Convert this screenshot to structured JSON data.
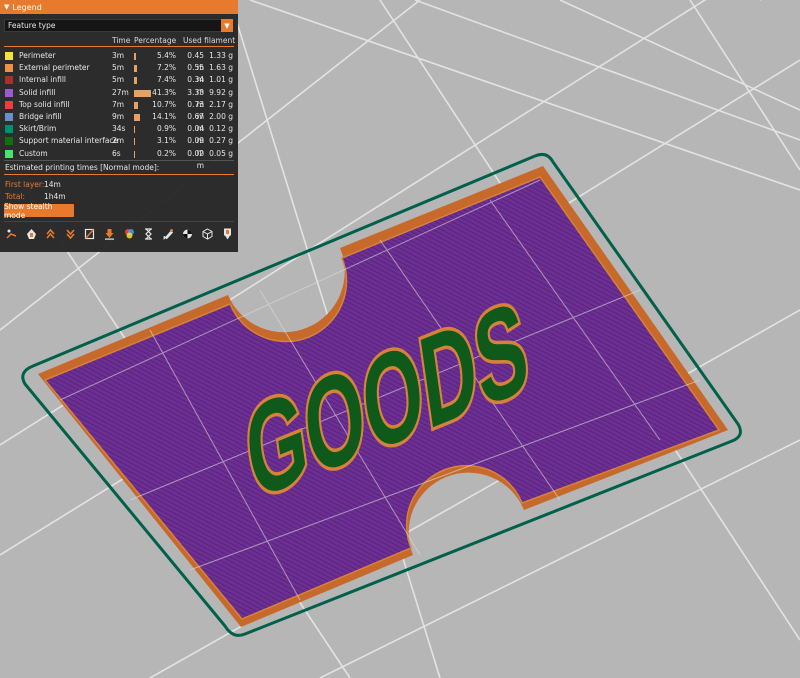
{
  "legend": {
    "title": "Legend",
    "view_type": "Feature type",
    "columns": {
      "time": "Time",
      "percentage": "Percentage",
      "used_filament": "Used filament"
    },
    "items": [
      {
        "name": "Perimeter",
        "color": "#f5e23a",
        "time": "3m",
        "percent": "5.4%",
        "fraction": 0.054,
        "length": "0.45 m",
        "weight": "1.33 g"
      },
      {
        "name": "External perimeter",
        "color": "#f09048",
        "time": "5m",
        "percent": "7.2%",
        "fraction": 0.072,
        "length": "0.55 m",
        "weight": "1.63 g"
      },
      {
        "name": "Internal infill",
        "color": "#a8302a",
        "time": "5m",
        "percent": "7.4%",
        "fraction": 0.074,
        "length": "0.34 m",
        "weight": "1.01 g"
      },
      {
        "name": "Solid infill",
        "color": "#9a5ad0",
        "time": "27m",
        "percent": "41.3%",
        "fraction": 0.413,
        "length": "3.33 m",
        "weight": "9.92 g"
      },
      {
        "name": "Top solid infill",
        "color": "#e84040",
        "time": "7m",
        "percent": "10.7%",
        "fraction": 0.107,
        "length": "0.73 m",
        "weight": "2.17 g"
      },
      {
        "name": "Bridge infill",
        "color": "#6a8ec8",
        "time": "9m",
        "percent": "14.1%",
        "fraction": 0.141,
        "length": "0.67 m",
        "weight": "2.00 g"
      },
      {
        "name": "Skirt/Brim",
        "color": "#009070",
        "time": "34s",
        "percent": "0.9%",
        "fraction": 0.009,
        "length": "0.04 m",
        "weight": "0.12 g"
      },
      {
        "name": "Support material interface",
        "color": "#107010",
        "time": "2m",
        "percent": "3.1%",
        "fraction": 0.031,
        "length": "0.09 m",
        "weight": "0.27 g"
      },
      {
        "name": "Custom",
        "color": "#50e070",
        "time": "6s",
        "percent": "0.2%",
        "fraction": 0.002,
        "length": "0.02 m",
        "weight": "0.05 g"
      }
    ],
    "estimated_label": "Estimated printing times [Normal mode]:",
    "first_layer_label": "First layer:",
    "first_layer_value": "14m",
    "total_label": "Total:",
    "total_value": "1h4m",
    "stealth_button": "Show stealth mode",
    "toolbar_icons": [
      "travel-icon",
      "wipe-icon",
      "retractions-icon",
      "deretractions-icon",
      "seams-icon",
      "tool-changes-icon",
      "color-changes-icon",
      "pause-prints-icon",
      "custom-gcodes-icon",
      "center-of-gravity-icon",
      "shells-icon",
      "tool-marker-icon"
    ]
  },
  "preview": {
    "text_model": "GOODS",
    "colors": {
      "background": "#b6b6b6",
      "solid_infill": "#6c2f92",
      "external_perimeter": "#c6692a",
      "skirt": "#00604a",
      "support_interface": "#0f5a1a"
    }
  }
}
